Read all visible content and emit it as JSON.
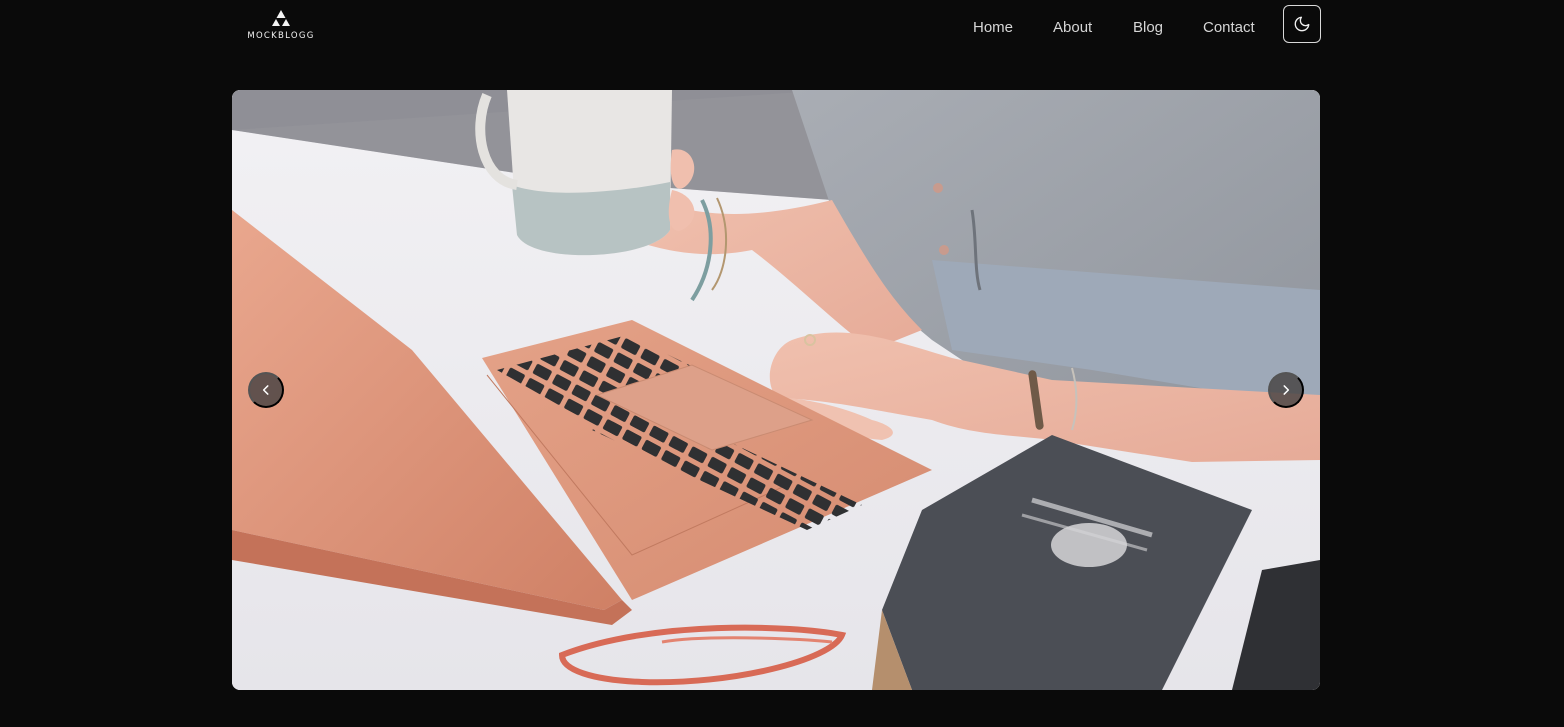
{
  "brand": {
    "name": "MOCKBLOGG",
    "logo_icon": "triangle-mountain-icon"
  },
  "nav": {
    "items": [
      {
        "label": "Home"
      },
      {
        "label": "About"
      },
      {
        "label": "Blog"
      },
      {
        "label": "Contact"
      }
    ],
    "theme_toggle_icon": "moon-icon"
  },
  "carousel": {
    "image_alt": "Person typing on a rose-gold laptop while holding a mug",
    "prev_icon": "chevron-left-icon",
    "next_icon": "chevron-right-icon"
  },
  "colors": {
    "background": "#0a0a0a",
    "nav_text": "#d6d6d6",
    "border": "#d9d9d9"
  }
}
